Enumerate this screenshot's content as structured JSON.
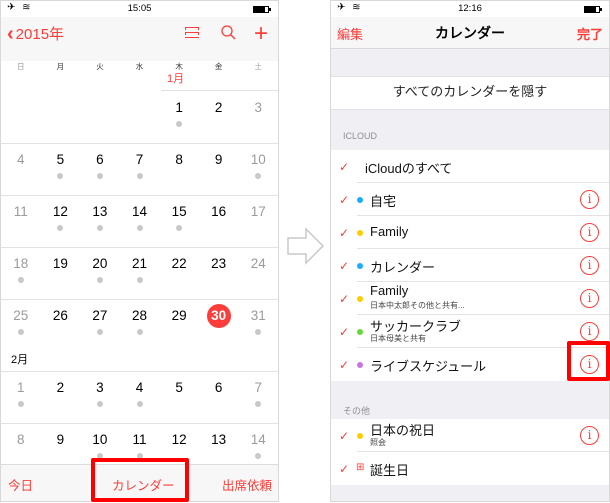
{
  "left": {
    "status": {
      "signal": "✈ ᯤ",
      "time": "15:05"
    },
    "nav": {
      "back_label": "2015年",
      "back_icon": "chevron-left-icon",
      "icons": [
        "list-icon",
        "search-icon",
        "plus-icon"
      ]
    },
    "weekdays": [
      "日",
      "月",
      "火",
      "水",
      "木",
      "金",
      "土"
    ],
    "months": {
      "jan": "1月",
      "feb": "2月"
    },
    "weeks": [
      [
        {
          "d": ""
        },
        {
          "d": ""
        },
        {
          "d": ""
        },
        {
          "d": ""
        },
        {
          "d": "1",
          "dot": true
        },
        {
          "d": "2"
        },
        {
          "d": "3"
        }
      ],
      [
        {
          "d": "4"
        },
        {
          "d": "5",
          "dot": true
        },
        {
          "d": "6",
          "dot": true
        },
        {
          "d": "7",
          "dot": true
        },
        {
          "d": "8"
        },
        {
          "d": "9"
        },
        {
          "d": "10",
          "dot": true
        }
      ],
      [
        {
          "d": "11"
        },
        {
          "d": "12",
          "dot": true
        },
        {
          "d": "13",
          "dot": true
        },
        {
          "d": "14",
          "dot": true
        },
        {
          "d": "15",
          "dot": true
        },
        {
          "d": "16"
        },
        {
          "d": "17"
        }
      ],
      [
        {
          "d": "18",
          "dot": true
        },
        {
          "d": "19"
        },
        {
          "d": "20",
          "dot": true
        },
        {
          "d": "21",
          "dot": true
        },
        {
          "d": "22"
        },
        {
          "d": "23"
        },
        {
          "d": "24"
        }
      ],
      [
        {
          "d": "25",
          "dot": true
        },
        {
          "d": "26"
        },
        {
          "d": "27",
          "dot": true
        },
        {
          "d": "28",
          "dot": true
        },
        {
          "d": "29"
        },
        {
          "d": "30",
          "today": true
        },
        {
          "d": "31",
          "dot": true
        }
      ],
      [
        {
          "d": "1",
          "dot": true
        },
        {
          "d": "2"
        },
        {
          "d": "3",
          "dot": true
        },
        {
          "d": "4",
          "dot": true
        },
        {
          "d": "5"
        },
        {
          "d": "6"
        },
        {
          "d": "7",
          "dot": true
        }
      ],
      [
        {
          "d": "8"
        },
        {
          "d": "9"
        },
        {
          "d": "10",
          "dot": true
        },
        {
          "d": "11",
          "dot": true
        },
        {
          "d": "12"
        },
        {
          "d": "13"
        },
        {
          "d": "14",
          "dot": true
        }
      ]
    ],
    "toolbar": {
      "today": "今日",
      "calendars": "カレンダー",
      "invitations": "出席依頼"
    }
  },
  "right": {
    "status": {
      "signal": "✈ ᯤ",
      "time": "12:16"
    },
    "nav": {
      "edit": "編集",
      "title": "カレンダー",
      "done": "完了"
    },
    "hide_all": "すべてのカレンダーを隠す",
    "sections": [
      {
        "header": "ICLOUD",
        "items": [
          {
            "name": "iCloudのすべて",
            "checked": true
          },
          {
            "name": "自宅",
            "checked": true,
            "color": "#1badf8",
            "info": true
          },
          {
            "name": "Family",
            "checked": true,
            "color": "#ffcc00",
            "info": true
          },
          {
            "name": "カレンダー",
            "checked": true,
            "color": "#1badf8",
            "info": true
          },
          {
            "name": "Family",
            "sub": "日本中太郎その他と共有...",
            "checked": true,
            "color": "#ffcc00",
            "info": true
          },
          {
            "name": "サッカークラブ",
            "sub": "日本母美と共有",
            "checked": true,
            "color": "#63da38",
            "info": true
          },
          {
            "name": "ライブスケジュール",
            "checked": true,
            "color": "#cc73e1",
            "info": true,
            "highlighted": true
          }
        ]
      },
      {
        "header": "その他",
        "items": [
          {
            "name": "日本の祝日",
            "sub": "照会",
            "checked": true,
            "color": "#ffcc00",
            "info": true
          },
          {
            "name": "誕生日",
            "checked": true,
            "icon": "gift-icon"
          }
        ]
      }
    ],
    "check_glyph": "✓",
    "info_glyph": "i",
    "gift_glyph": "🎁"
  },
  "colors": {
    "accent": "#fc3d39",
    "highlight": "#ff0000",
    "dot": "#c8c8c8"
  }
}
